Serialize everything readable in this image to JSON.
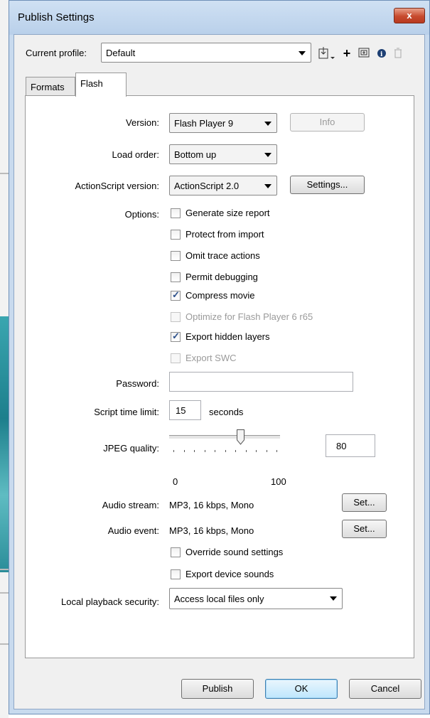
{
  "window": {
    "title": "Publish Settings",
    "close_label": "x"
  },
  "profile": {
    "label": "Current profile:",
    "value": "Default"
  },
  "tabs": [
    {
      "label": "Formats"
    },
    {
      "label": "Flash"
    }
  ],
  "version": {
    "label": "Version:",
    "value": "Flash Player 9",
    "info_label": "Info"
  },
  "load_order": {
    "label": "Load order:",
    "value": "Bottom up"
  },
  "actionscript": {
    "label": "ActionScript version:",
    "value": "ActionScript 2.0",
    "settings_label": "Settings..."
  },
  "options": {
    "label": "Options:",
    "items": [
      {
        "label": "Generate size report",
        "checked": false,
        "enabled": true
      },
      {
        "label": "Protect from import",
        "checked": false,
        "enabled": true
      },
      {
        "label": "Omit trace actions",
        "checked": false,
        "enabled": true
      },
      {
        "label": "Permit debugging",
        "checked": false,
        "enabled": true
      },
      {
        "label": "Compress movie",
        "checked": true,
        "enabled": true
      },
      {
        "label": "Optimize for Flash Player 6 r65",
        "checked": false,
        "enabled": false
      },
      {
        "label": "Export hidden layers",
        "checked": true,
        "enabled": true
      },
      {
        "label": "Export SWC",
        "checked": false,
        "enabled": false
      }
    ]
  },
  "password": {
    "label": "Password:",
    "value": ""
  },
  "script_time": {
    "label": "Script time limit:",
    "value": "15",
    "unit": "seconds"
  },
  "jpeg": {
    "label": "JPEG quality:",
    "value": "80",
    "min": "0",
    "max": "100",
    "level": 80
  },
  "audio_stream": {
    "label": "Audio stream:",
    "value": "MP3, 16 kbps, Mono",
    "set_label": "Set..."
  },
  "audio_event": {
    "label": "Audio event:",
    "value": "MP3, 16 kbps, Mono",
    "set_label": "Set..."
  },
  "sound_options": [
    {
      "label": "Override sound settings",
      "checked": false
    },
    {
      "label": "Export device sounds",
      "checked": false
    }
  ],
  "local_playback": {
    "label": "Local playback security:",
    "value": "Access local files only"
  },
  "footer": {
    "publish_label": "Publish",
    "ok_label": "OK",
    "cancel_label": "Cancel"
  },
  "icons": [
    "import-profile-icon",
    "add-profile-icon",
    "duplicate-profile-icon",
    "profile-info-icon",
    "delete-profile-icon"
  ]
}
